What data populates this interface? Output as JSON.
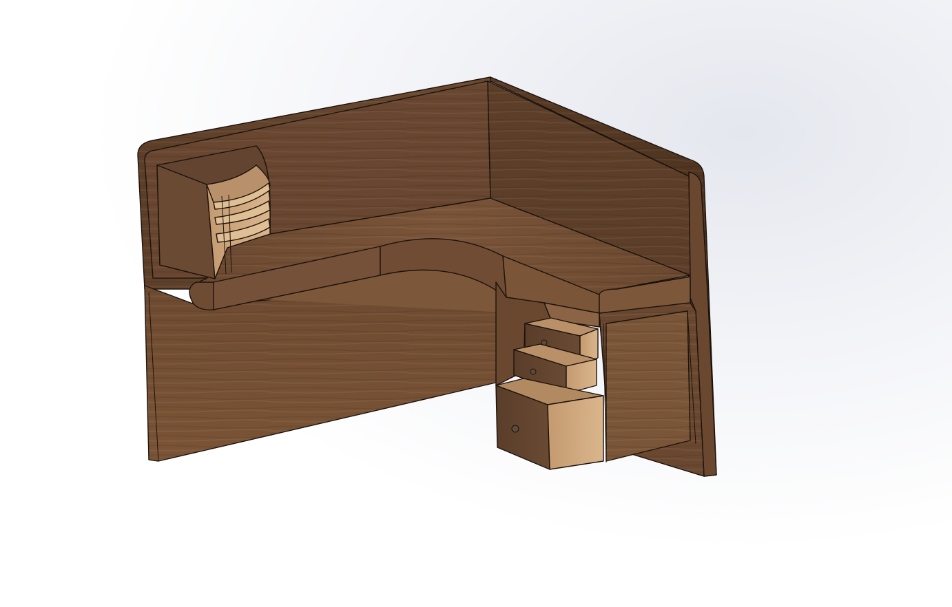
{
  "window": {
    "title": "",
    "background_color": "#ffffff",
    "background_tint": "#e4e7ee"
  },
  "model": {
    "description_visible": false,
    "material_colors": {
      "wood_dark": "#5a3d28",
      "wood_mid": "#6e4b31",
      "wood_light": "#8a603f",
      "wood_face": "#7a5336",
      "wood_interior": "#c9a27a",
      "wood_drawer": "#d2ab82",
      "outline": "#1b120c"
    },
    "drawers": [
      {
        "name": "top-drawer",
        "open": true
      },
      {
        "name": "middle-drawer",
        "open": true
      },
      {
        "name": "bottom-drawer",
        "open": true
      }
    ],
    "shelf_unit": {
      "shelves": 3
    }
  }
}
